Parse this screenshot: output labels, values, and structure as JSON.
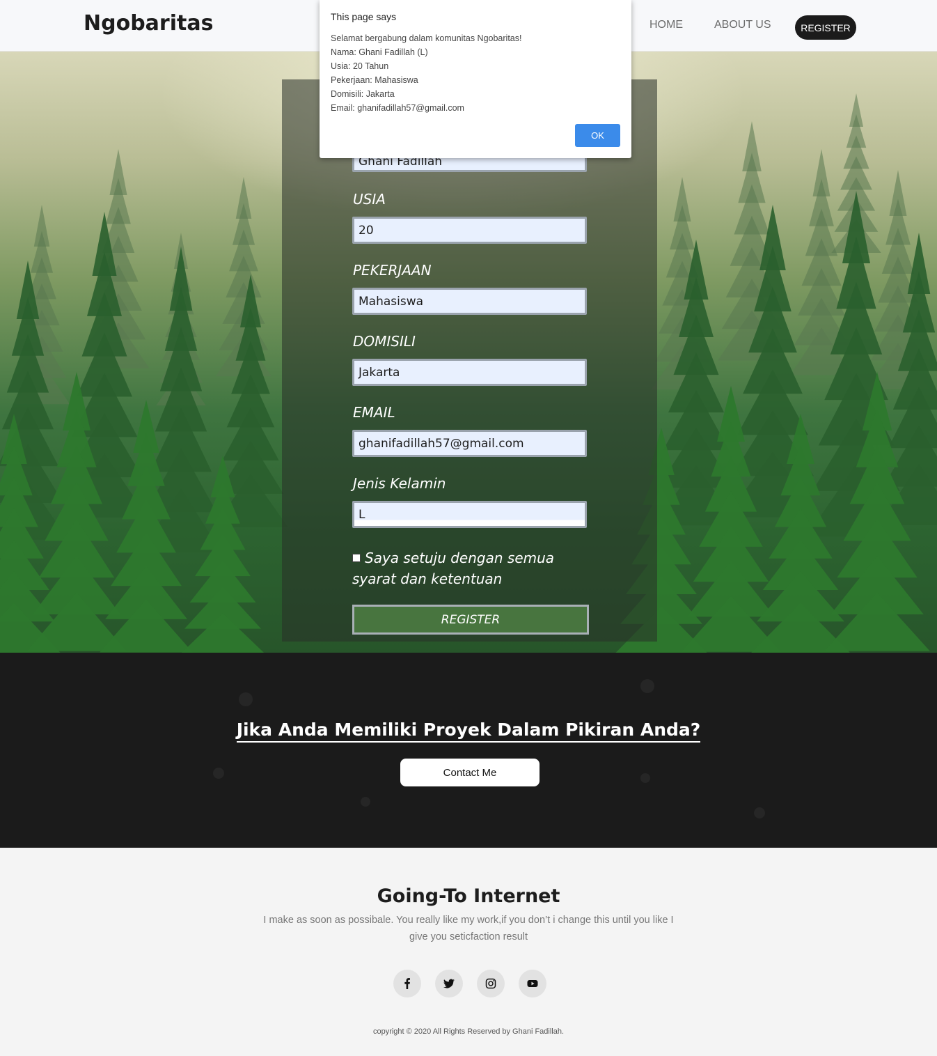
{
  "navbar": {
    "brand": "Ngobaritas",
    "home": "HOME",
    "about": "ABOUT US",
    "register": "REGISTER"
  },
  "dialog": {
    "title": "This page says",
    "lines": [
      "Selamat bergabung dalam komunitas Ngobaritas!",
      "Nama: Ghani Fadillah (L)",
      "Usia: 20 Tahun",
      "Pekerjaan: Mahasiswa",
      "Domisili: Jakarta",
      "Email: ghanifadillah57@gmail.com"
    ],
    "ok": "OK"
  },
  "form": {
    "nama_value": "Ghani Fadillah",
    "usia_label": "USIA",
    "usia_value": "20",
    "pekerjaan_label": "PEKERJAAN",
    "pekerjaan_value": "Mahasiswa",
    "domisili_label": "DOMISILI",
    "domisili_value": "Jakarta",
    "email_label": "EMAIL",
    "email_value": "ghanifadillah57@gmail.com",
    "gender_label": "Jenis Kelamin",
    "gender_value": "L",
    "agree_label": "Saya setuju dengan semua syarat dan ketentuan",
    "submit": "REGISTER"
  },
  "cta": {
    "title": "Jika Anda Memiliki Proyek Dalam Pikiran Anda?",
    "button": "Contact Me"
  },
  "footer": {
    "title": "Going-To Internet",
    "text": "I make as soon as possibale. You really like my work,if you don’t i change this until you like I give you seticfaction result",
    "social": [
      "facebook-icon",
      "twitter-icon",
      "instagram-icon",
      "youtube-icon"
    ],
    "copyright": "copyright © 2020 All Rights Reserved by Ghani Fadillah."
  },
  "colors": {
    "accent_green": "#48753f",
    "dialog_ok_blue": "#3b8bea",
    "dark": "#1b1b1b",
    "input_bg": "#e8f0fe"
  }
}
